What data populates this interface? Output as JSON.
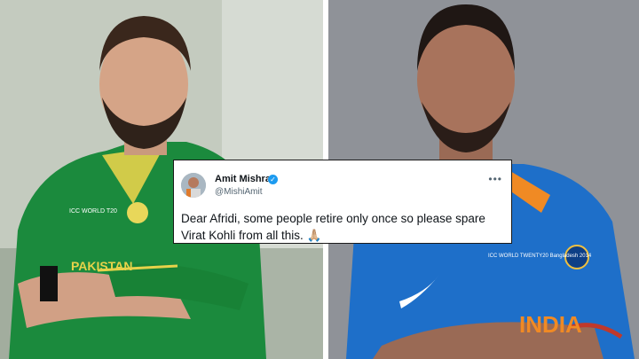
{
  "tweet": {
    "display_name": "Amit Mishra",
    "verified_badge": "verified-badge-icon",
    "handle": "@MishiAmit",
    "more_menu": "ellipsis-icon",
    "text": "Dear Afridi, some people retire only once so please spare Virat Kohli from all this. 🙏🏼"
  },
  "left_photo": {
    "jersey_text": "PAKISTAN",
    "badge_text": "ICC WORLD T20"
  },
  "right_photo": {
    "badge_text": "ICC WORLD TWENTY20 Bangladesh 2014",
    "jersey_text": "INDIA"
  },
  "colors": {
    "pakistan_green": "#1b8a3d",
    "india_blue": "#1e6fc9",
    "twitter_blue": "#1d9bf0"
  }
}
